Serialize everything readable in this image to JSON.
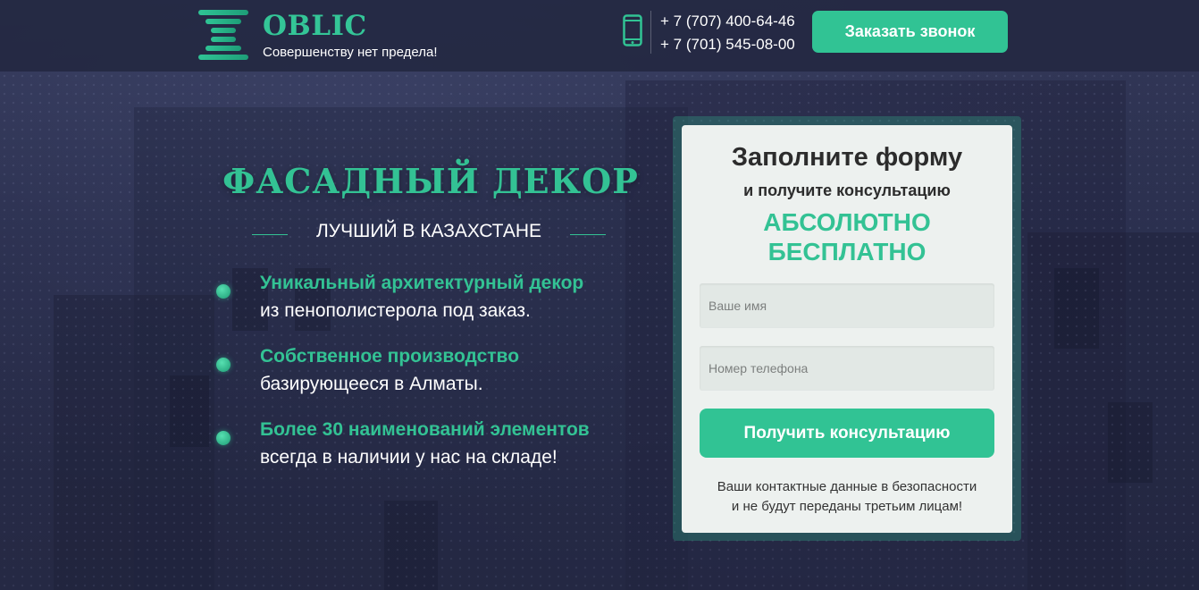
{
  "header": {
    "logo_name": "OBLIC",
    "logo_slogan": "Совершенству нет предела!",
    "phones": [
      "+ 7 (707) 400-64-46",
      "+ 7 (701) 545-08-00"
    ],
    "call_button": "Заказать звонок"
  },
  "hero": {
    "title": "ФАСАДНЫЙ ДЕКОР",
    "subtitle": "ЛУЧШИЙ В КАЗАХСТАНЕ",
    "features": [
      {
        "head": "Уникальный архитектурный декор",
        "body": "из пенополистерола под заказ."
      },
      {
        "head": "Собственное производство",
        "body": "базирующееся в Алматы."
      },
      {
        "head": "Более 30 наименований элементов",
        "body": "всегда в наличии у нас на складе!"
      }
    ]
  },
  "form": {
    "title": "Заполните форму",
    "subtitle": "и получите консультацию",
    "free_line1": "АБСОЛЮТНО",
    "free_line2": "БЕСПЛАТНО",
    "name_placeholder": "Ваше имя",
    "phone_placeholder": "Номер телефона",
    "submit_label": "Получить консультацию",
    "privacy_line1": "Ваши контактные данные в безопасности",
    "privacy_line2": "и не будут переданы третьим лицам!"
  },
  "colors": {
    "accent": "#31c394",
    "header_bg": "#242842",
    "form_bg": "#edf1ef"
  },
  "icons": {
    "logo": "stacked-bars-logo-icon",
    "phone": "smartphone-icon",
    "bullet": "green-dot-bullet-icon"
  }
}
